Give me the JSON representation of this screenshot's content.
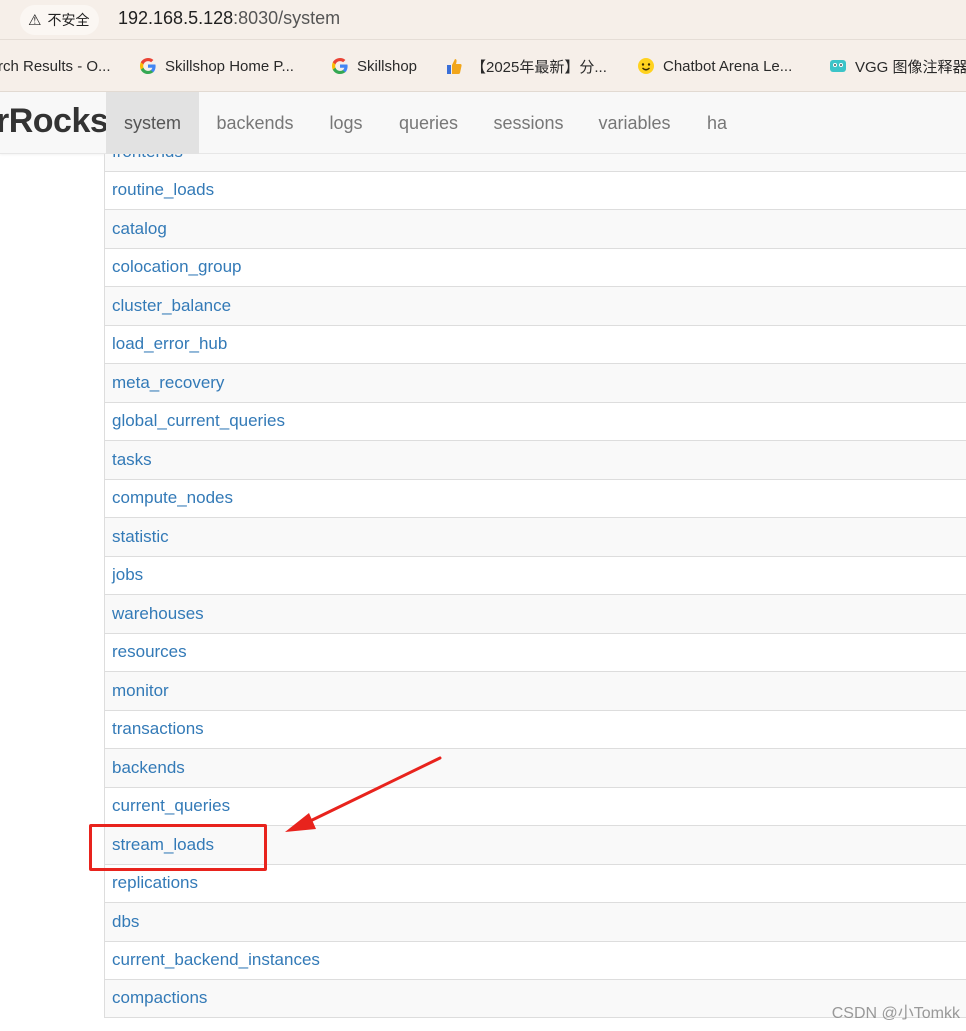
{
  "browser": {
    "security_label": "不安全",
    "url_host": "192.168.5.128",
    "url_rest": ":8030/system"
  },
  "bookmarks": [
    {
      "label": "rch Results - O...",
      "icon": "results-icon"
    },
    {
      "label": "Skillshop Home P...",
      "icon": "google-icon"
    },
    {
      "label": "Skillshop",
      "icon": "google-icon"
    },
    {
      "label": "【2025年最新】分...",
      "icon": "thumbs-up-icon"
    },
    {
      "label": "Chatbot Arena Le...",
      "icon": "hugging-face-icon"
    },
    {
      "label": "VGG 图像注释器",
      "icon": "vgg-icon"
    }
  ],
  "app": {
    "brand": "rRocks"
  },
  "nav": {
    "tabs": [
      "system",
      "backends",
      "logs",
      "queries",
      "sessions",
      "variables",
      "ha"
    ],
    "active": "system"
  },
  "table": {
    "rows": [
      "frontends",
      "routine_loads",
      "catalog",
      "colocation_group",
      "cluster_balance",
      "load_error_hub",
      "meta_recovery",
      "global_current_queries",
      "tasks",
      "compute_nodes",
      "statistic",
      "jobs",
      "warehouses",
      "resources",
      "monitor",
      "transactions",
      "backends",
      "current_queries",
      "stream_loads",
      "replications",
      "dbs",
      "current_backend_instances",
      "compactions"
    ],
    "highlighted": "stream_loads"
  },
  "colors": {
    "link": "#337ab7",
    "annotation": "#e8231d"
  },
  "watermark": "CSDN @小Tomkk"
}
